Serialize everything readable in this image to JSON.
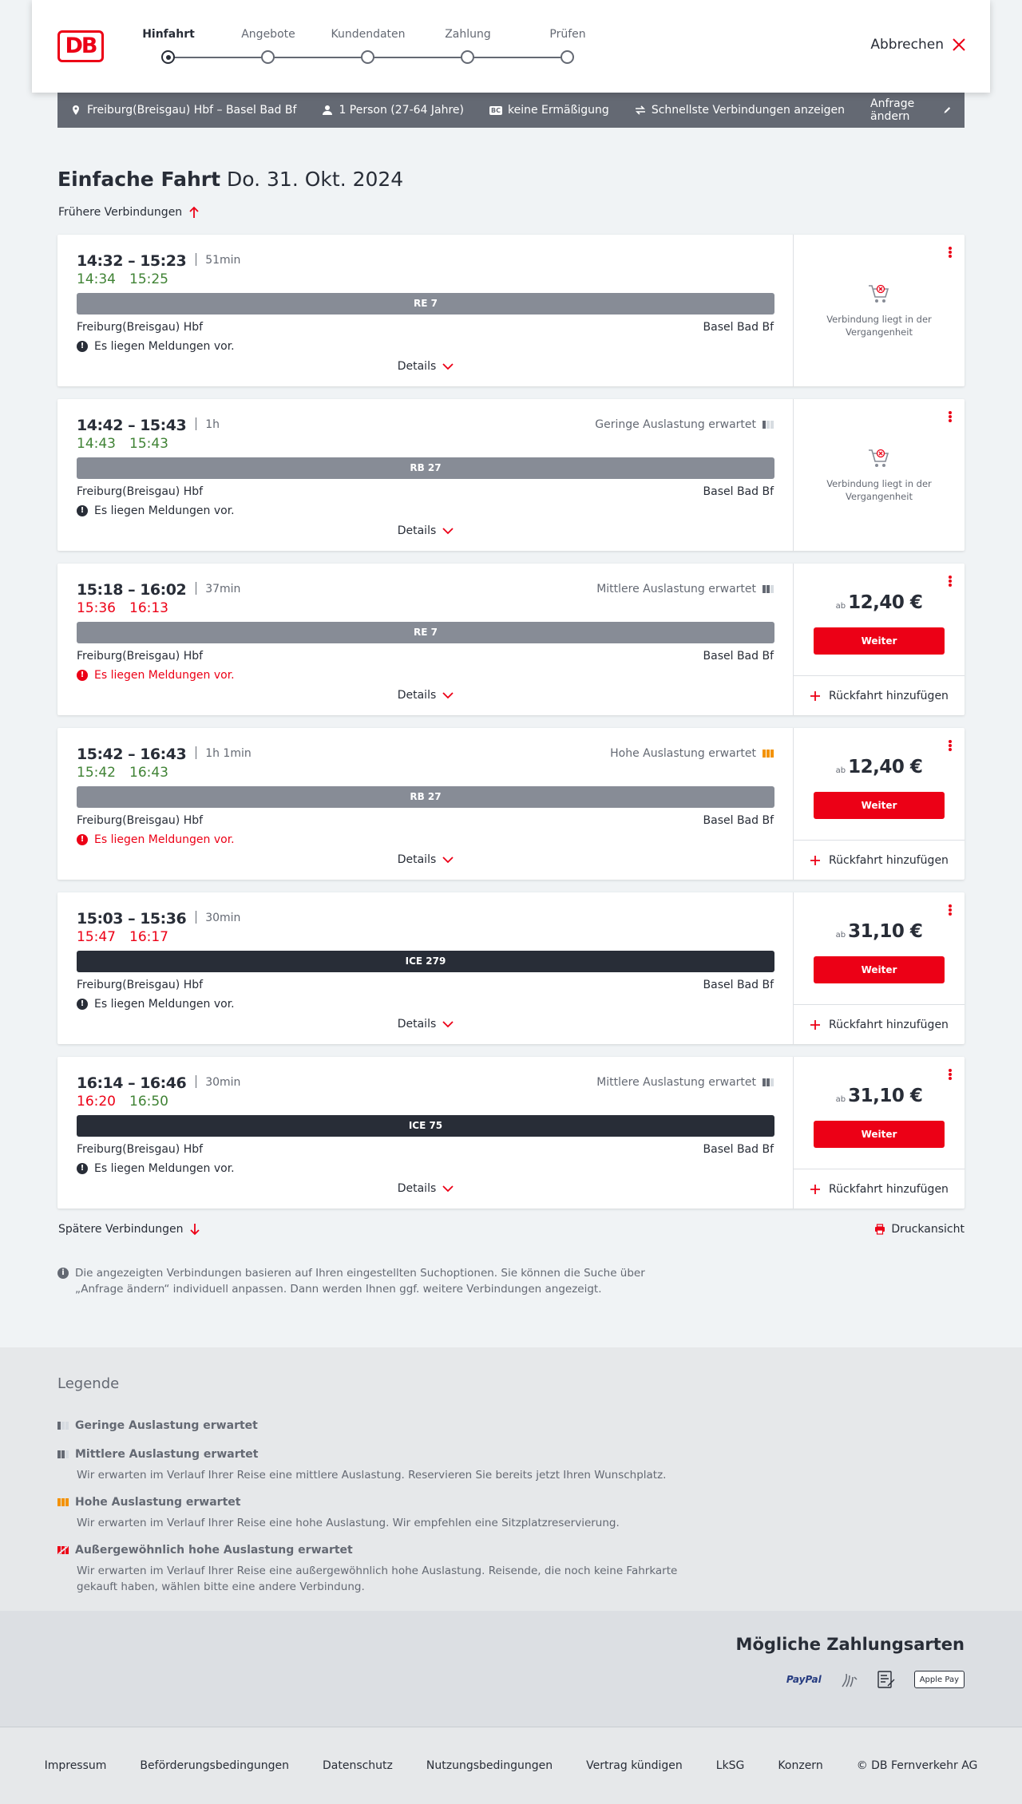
{
  "steps": [
    {
      "label": "Hinfahrt",
      "active": true
    },
    {
      "label": "Angebote"
    },
    {
      "label": "Kundendaten"
    },
    {
      "label": "Zahlung"
    },
    {
      "label": "Prüfen"
    }
  ],
  "header": {
    "logo": "DB",
    "cancel_label": "Abbrechen"
  },
  "query": {
    "route": "Freiburg(Breisgau) Hbf – Basel Bad Bf",
    "passengers": "1 Person (27-64 Jahre)",
    "discount": "keine Ermäßigung",
    "fastest": "Schnellste Verbindungen anzeigen",
    "change": "Anfrage ändern",
    "discount_badge": "BC"
  },
  "title": {
    "type": "Einfache Fahrt",
    "date": "Do. 31. Okt. 2024"
  },
  "earlier": "Frühere Verbindungen",
  "later": "Spätere Verbindungen",
  "print": "Druckansicht",
  "connections": [
    {
      "times": "14:32 – 15:23",
      "duration": "51min",
      "rt_dep": "14:34",
      "rt_arr": "15:25",
      "rt_dep_color": "green",
      "rt_arr_color": "green",
      "train": "RE 7",
      "dark": false,
      "from": "Freiburg(Breisgau) Hbf",
      "to": "Basel Bad Bf",
      "message": "Es liegen Meldungen vor.",
      "msg_red": false,
      "details": "Details",
      "load": "",
      "load_level": 0,
      "past": true,
      "past_text": "Verbindung liegt in der Vergangenheit"
    },
    {
      "times": "14:42 – 15:43",
      "duration": "1h",
      "rt_dep": "14:43",
      "rt_arr": "15:43",
      "rt_dep_color": "green",
      "rt_arr_color": "green",
      "train": "RB 27",
      "dark": false,
      "from": "Freiburg(Breisgau) Hbf",
      "to": "Basel Bad Bf",
      "message": "Es liegen Meldungen vor.",
      "msg_red": false,
      "details": "Details",
      "load": "Geringe Auslastung erwartet",
      "load_level": 1,
      "past": true,
      "past_text": "Verbindung liegt in der Vergangenheit"
    },
    {
      "times": "15:18 – 16:02",
      "duration": "37min",
      "rt_dep": "15:36",
      "rt_arr": "16:13",
      "rt_dep_color": "red",
      "rt_arr_color": "red",
      "train": "RE 7",
      "dark": false,
      "from": "Freiburg(Breisgau) Hbf",
      "to": "Basel Bad Bf",
      "message": "Es liegen Meldungen vor.",
      "msg_red": true,
      "details": "Details",
      "load": "Mittlere Auslastung erwartet",
      "load_level": 2,
      "past": false,
      "price_prefix": "ab",
      "price": "12,40 €",
      "button": "Weiter",
      "return": "Rückfahrt hinzufügen"
    },
    {
      "times": "15:42 – 16:43",
      "duration": "1h 1min",
      "rt_dep": "15:42",
      "rt_arr": "16:43",
      "rt_dep_color": "green",
      "rt_arr_color": "green",
      "train": "RB 27",
      "dark": false,
      "from": "Freiburg(Breisgau) Hbf",
      "to": "Basel Bad Bf",
      "message": "Es liegen Meldungen vor.",
      "msg_red": true,
      "details": "Details",
      "load": "Hohe Auslastung erwartet",
      "load_level": 3,
      "past": false,
      "price_prefix": "ab",
      "price": "12,40 €",
      "button": "Weiter",
      "return": "Rückfahrt hinzufügen"
    },
    {
      "times": "15:03 – 15:36",
      "duration": "30min",
      "rt_dep": "15:47",
      "rt_arr": "16:17",
      "rt_dep_color": "red",
      "rt_arr_color": "red",
      "train": "ICE 279",
      "dark": true,
      "from": "Freiburg(Breisgau) Hbf",
      "to": "Basel Bad Bf",
      "message": "Es liegen Meldungen vor.",
      "msg_red": false,
      "details": "Details",
      "load": "",
      "load_level": 0,
      "past": false,
      "price_prefix": "ab",
      "price": "31,10 €",
      "button": "Weiter",
      "return": "Rückfahrt hinzufügen"
    },
    {
      "times": "16:14 – 16:46",
      "duration": "30min",
      "rt_dep": "16:20",
      "rt_arr": "16:50",
      "rt_dep_color": "red",
      "rt_arr_color": "green",
      "train": "ICE 75",
      "dark": true,
      "from": "Freiburg(Breisgau) Hbf",
      "to": "Basel Bad Bf",
      "message": "Es liegen Meldungen vor.",
      "msg_red": false,
      "details": "Details",
      "load": "Mittlere Auslastung erwartet",
      "load_level": 2,
      "past": false,
      "price_prefix": "ab",
      "price": "31,10 €",
      "button": "Weiter",
      "return": "Rückfahrt hinzufügen"
    }
  ],
  "info": "Die angezeigten Verbindungen basieren auf Ihren eingestellten Suchoptionen. Sie können die Suche über „Anfrage ändern“ individuell anpassen. Dann werden Ihnen ggf. weitere Verbindungen angezeigt.",
  "legend": {
    "title": "Legende",
    "items": [
      {
        "title": "Geringe Auslastung erwartet",
        "desc": ""
      },
      {
        "title": "Mittlere Auslastung erwartet",
        "desc": "Wir erwarten im Verlauf Ihrer Reise eine mittlere Auslastung. Reservieren Sie bereits jetzt Ihren Wunschplatz."
      },
      {
        "title": "Hohe Auslastung erwartet",
        "desc": "Wir erwarten im Verlauf Ihrer Reise eine hohe Auslastung. Wir empfehlen eine Sitzplatzreservierung."
      },
      {
        "title": "Außergewöhnlich hohe Auslastung erwartet",
        "desc": "Wir erwarten im Verlauf Ihrer Reise eine außergewöhnlich hohe Auslastung. Reisende, die noch keine Fahrkarte gekauft haben, wählen bitte eine andere Verbindung."
      }
    ]
  },
  "payment": {
    "title": "Mögliche Zahlungsarten",
    "methods": [
      "PayPal",
      "Apple Pay"
    ]
  },
  "footer": [
    "Impressum",
    "Beförderungsbedingungen",
    "Datenschutz",
    "Nutzungsbedingungen",
    "Vertrag kündigen",
    "LkSG",
    "Konzern",
    "© DB Fernverkehr AG"
  ],
  "colors": {
    "brand_red": "#ec0016",
    "green": "#408335",
    "dark": "#282d37",
    "grey": "#646973",
    "orange": "#f39200"
  }
}
